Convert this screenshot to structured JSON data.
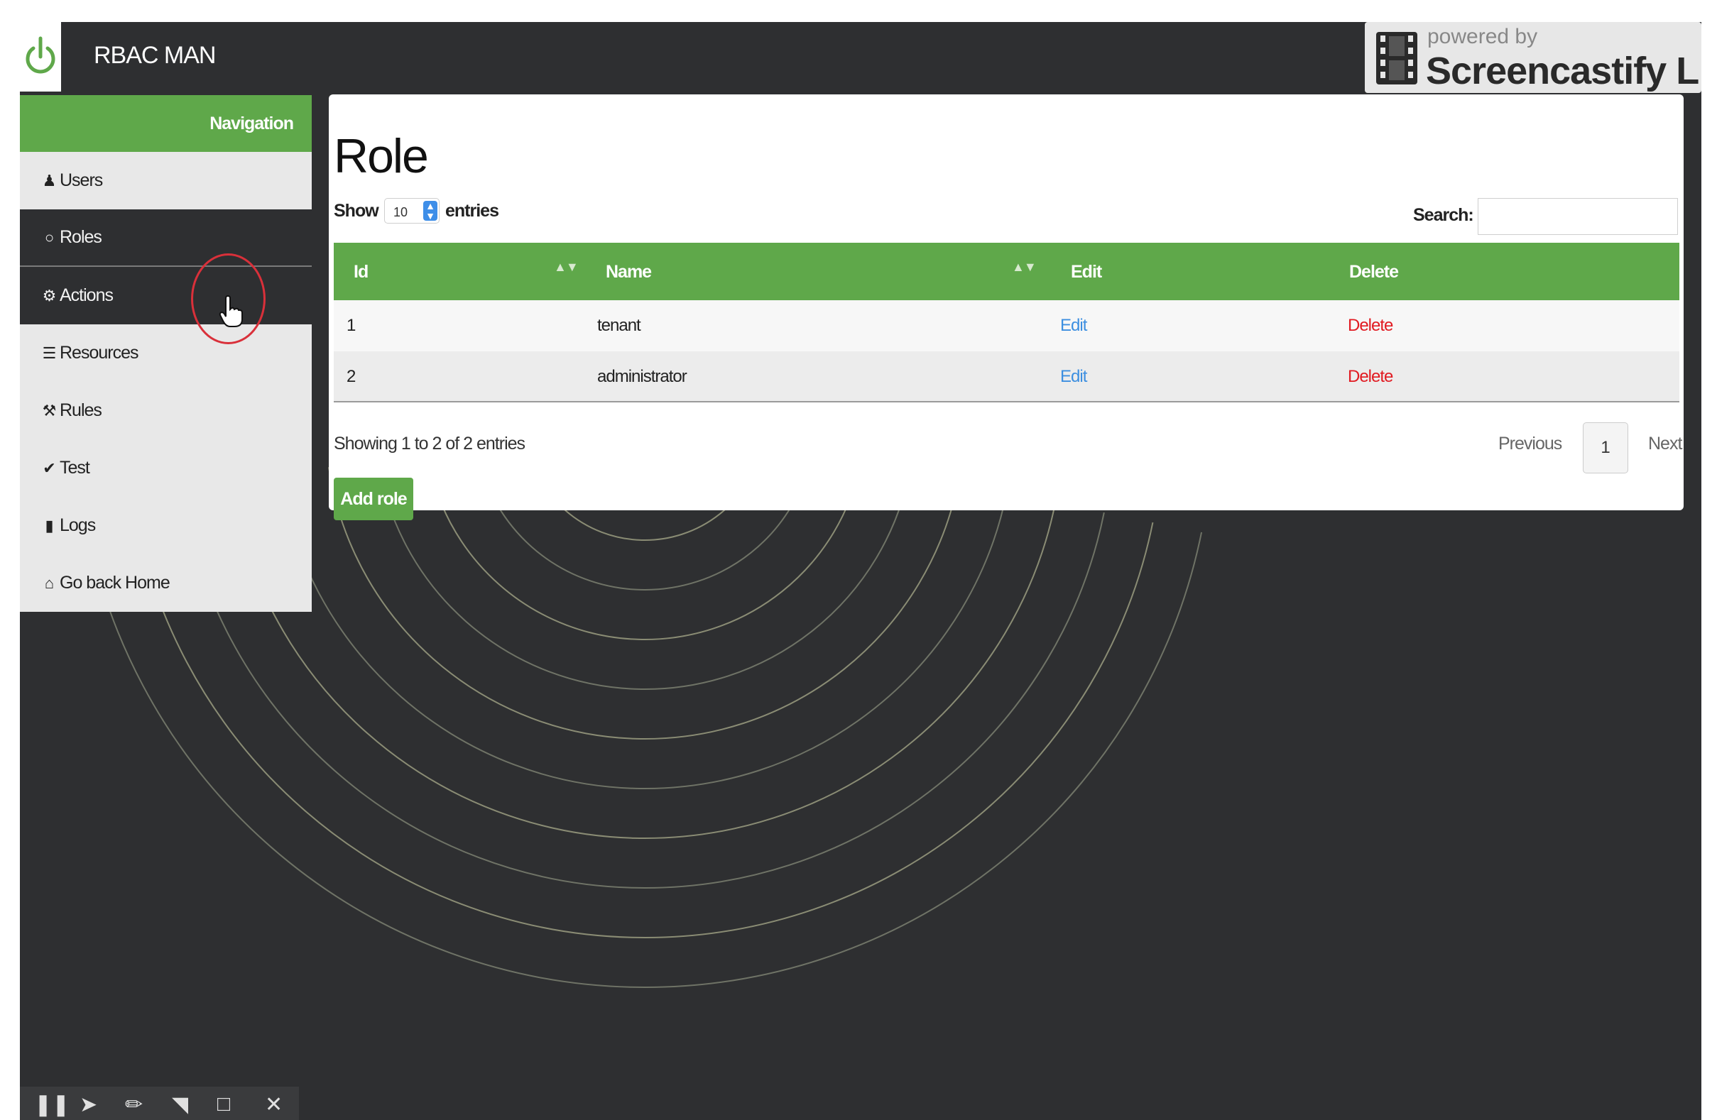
{
  "app": {
    "title": "RBAC MAN"
  },
  "watermark": {
    "powered_by": "powered by",
    "brand": "Screencastify Lite"
  },
  "navigation": {
    "header": "Navigation",
    "items": [
      {
        "label": "Users",
        "icon": "user-icon"
      },
      {
        "label": "Roles",
        "icon": "circle-icon"
      },
      {
        "label": "Actions",
        "icon": "gear-icon"
      },
      {
        "label": "Resources",
        "icon": "list-icon"
      },
      {
        "label": "Rules",
        "icon": "gavel-icon"
      },
      {
        "label": "Test",
        "icon": "check-icon"
      },
      {
        "label": "Logs",
        "icon": "file-icon"
      },
      {
        "label": "Go back Home",
        "icon": "home-icon"
      }
    ]
  },
  "page": {
    "title": "Role",
    "show_label": "Show",
    "entries_value": "10",
    "entries_label": "entries",
    "search_label": "Search:",
    "search_value": "",
    "columns": [
      "Id",
      "Name",
      "Edit",
      "Delete"
    ],
    "rows": [
      {
        "id": "1",
        "name": "tenant",
        "edit": "Edit",
        "delete": "Delete"
      },
      {
        "id": "2",
        "name": "administrator",
        "edit": "Edit",
        "delete": "Delete"
      }
    ],
    "info": "Showing 1 to 2 of 2 entries",
    "pagination": {
      "previous": "Previous",
      "current": "1",
      "next": "Next"
    },
    "add_button": "Add role"
  },
  "colors": {
    "accent": "#5fa84a",
    "background": "#2e2f31",
    "link": "#3d8fe0",
    "danger": "#e11b22"
  }
}
